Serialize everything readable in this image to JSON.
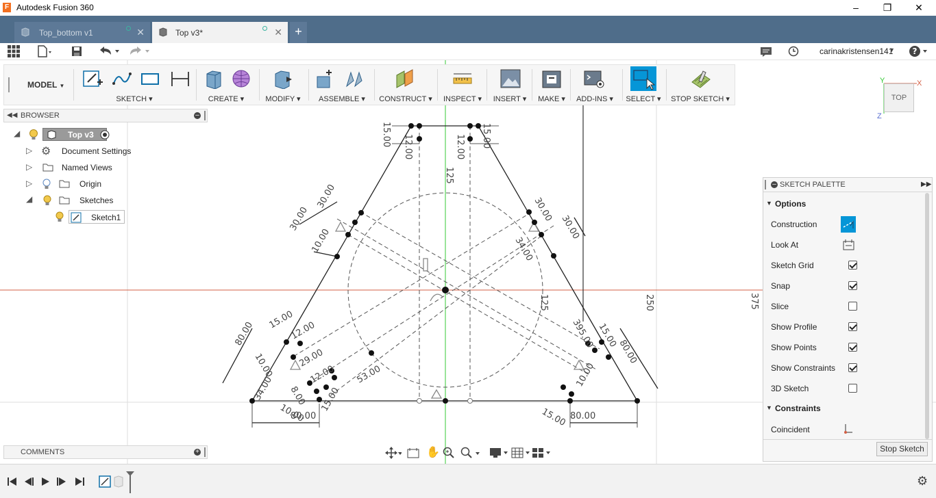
{
  "window": {
    "title": "Autodesk Fusion 360",
    "logo_letter": "F"
  },
  "tabs": [
    {
      "label": "Top_bottom v1",
      "active": false
    },
    {
      "label": "Top v3*",
      "active": true
    }
  ],
  "user": {
    "name": "carinakristensen141"
  },
  "toolbar": {
    "workspace": "MODEL",
    "groups": [
      "SKETCH",
      "CREATE",
      "MODIFY",
      "ASSEMBLE",
      "CONSTRUCT",
      "INSPECT",
      "INSERT",
      "MAKE",
      "ADD-INS",
      "SELECT",
      "STOP SKETCH"
    ]
  },
  "browser": {
    "title": "BROWSER",
    "root": "Top v3",
    "items": [
      "Document Settings",
      "Named Views",
      "Origin",
      "Sketches",
      "Sketch1"
    ]
  },
  "comments": {
    "title": "COMMENTS"
  },
  "viewcube": {
    "face": "TOP",
    "axis_x": "X",
    "axis_y": "Y",
    "axis_z": "Z"
  },
  "palette": {
    "title": "SKETCH PALETTE",
    "options_header": "Options",
    "options": [
      {
        "label": "Construction",
        "type": "toggle",
        "checked": true
      },
      {
        "label": "Look At",
        "type": "button"
      },
      {
        "label": "Sketch Grid",
        "type": "checkbox",
        "checked": true
      },
      {
        "label": "Snap",
        "type": "checkbox",
        "checked": true
      },
      {
        "label": "Slice",
        "type": "checkbox",
        "checked": false
      },
      {
        "label": "Show Profile",
        "type": "checkbox",
        "checked": true
      },
      {
        "label": "Show Points",
        "type": "checkbox",
        "checked": true
      },
      {
        "label": "Show Constraints",
        "type": "checkbox",
        "checked": true
      },
      {
        "label": "3D Sketch",
        "type": "checkbox",
        "checked": false
      }
    ],
    "constraints_header": "Constraints",
    "constraints": [
      "Coincident"
    ],
    "stop_button": "Stop Sketch"
  },
  "dimensions": {
    "d15a": "15.00",
    "d12a": "12.00",
    "d12b": "12.00",
    "d15b": "15.00",
    "d125a": "125",
    "d30a": "30.00",
    "d30b": "30.00",
    "d10a": "10.00",
    "d30c": "30.00",
    "d30d": "30.00",
    "d10b": "10.00",
    "d34a": "34.00",
    "d125b": "125",
    "d250": "250",
    "d375": "375",
    "d80a": "80.00",
    "d15c": "15.00",
    "d12c": "12.00",
    "d10c": "10.00",
    "d29": "29.00",
    "d12d": "12.00",
    "d53": "53.00",
    "d34b": "34.00",
    "d8": "8.00",
    "d10d": "10.00",
    "d80b": "80.00",
    "d15d": "15.00",
    "d395": "395.00",
    "d15e": "15.00",
    "d80c": "80.00",
    "d10e": "10.00",
    "d15f": "15.00",
    "d80d": "80.00"
  },
  "colors": {
    "accent": "#0696d7",
    "tabbar": "#4f6d8a",
    "x_axis": "#d35f44",
    "y_axis": "#34c834"
  }
}
